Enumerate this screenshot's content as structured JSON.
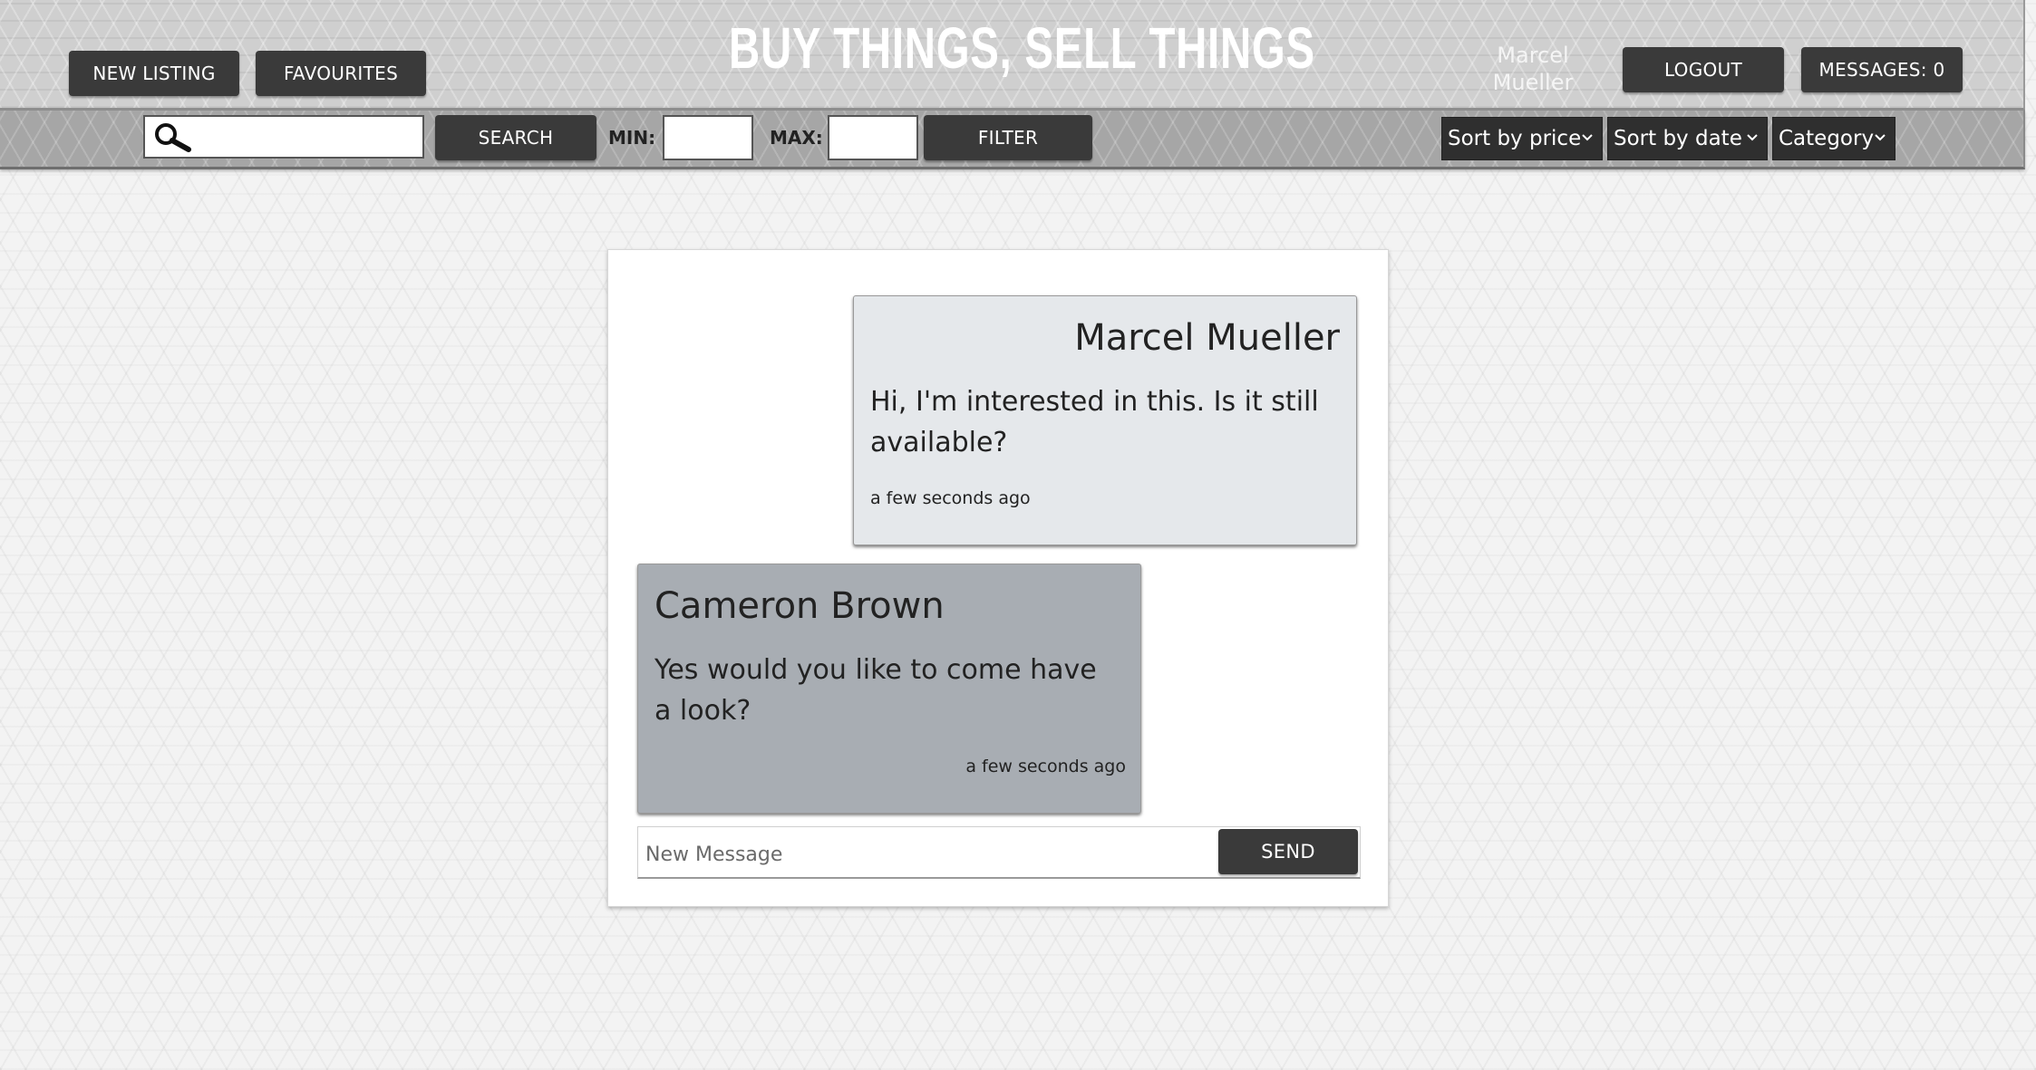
{
  "header": {
    "title": "BUY THINGS, SELL THINGS",
    "new_listing_label": "NEW LISTING",
    "favourites_label": "FAVOURITES",
    "user_name": "Marcel Mueller",
    "logout_label": "LOGOUT",
    "messages_label": "MESSAGES: 0"
  },
  "filters": {
    "search_placeholder": "",
    "search_label": "SEARCH",
    "min_label": "MIN:",
    "max_label": "MAX:",
    "filter_label": "FILTER",
    "sort_price_label": "Sort by price",
    "sort_date_label": "Sort by date",
    "category_label": "Category"
  },
  "chat": {
    "messages": [
      {
        "sender": "Marcel Mueller",
        "text": "Hi, I'm interested in this. Is it still available?",
        "time": "a few seconds ago"
      },
      {
        "sender": "Cameron Brown",
        "text": "Yes would you like to come have a look?",
        "time": "a few seconds ago"
      }
    ],
    "compose_placeholder": "New Message",
    "send_label": "SEND"
  },
  "colors": {
    "button_dark": "#3a3a3a",
    "my_message_bg": "#e5e8eb",
    "their_message_bg": "#a8adb3"
  },
  "icons": {
    "search": "search-icon",
    "dropdown": "chevron-down-icon"
  }
}
